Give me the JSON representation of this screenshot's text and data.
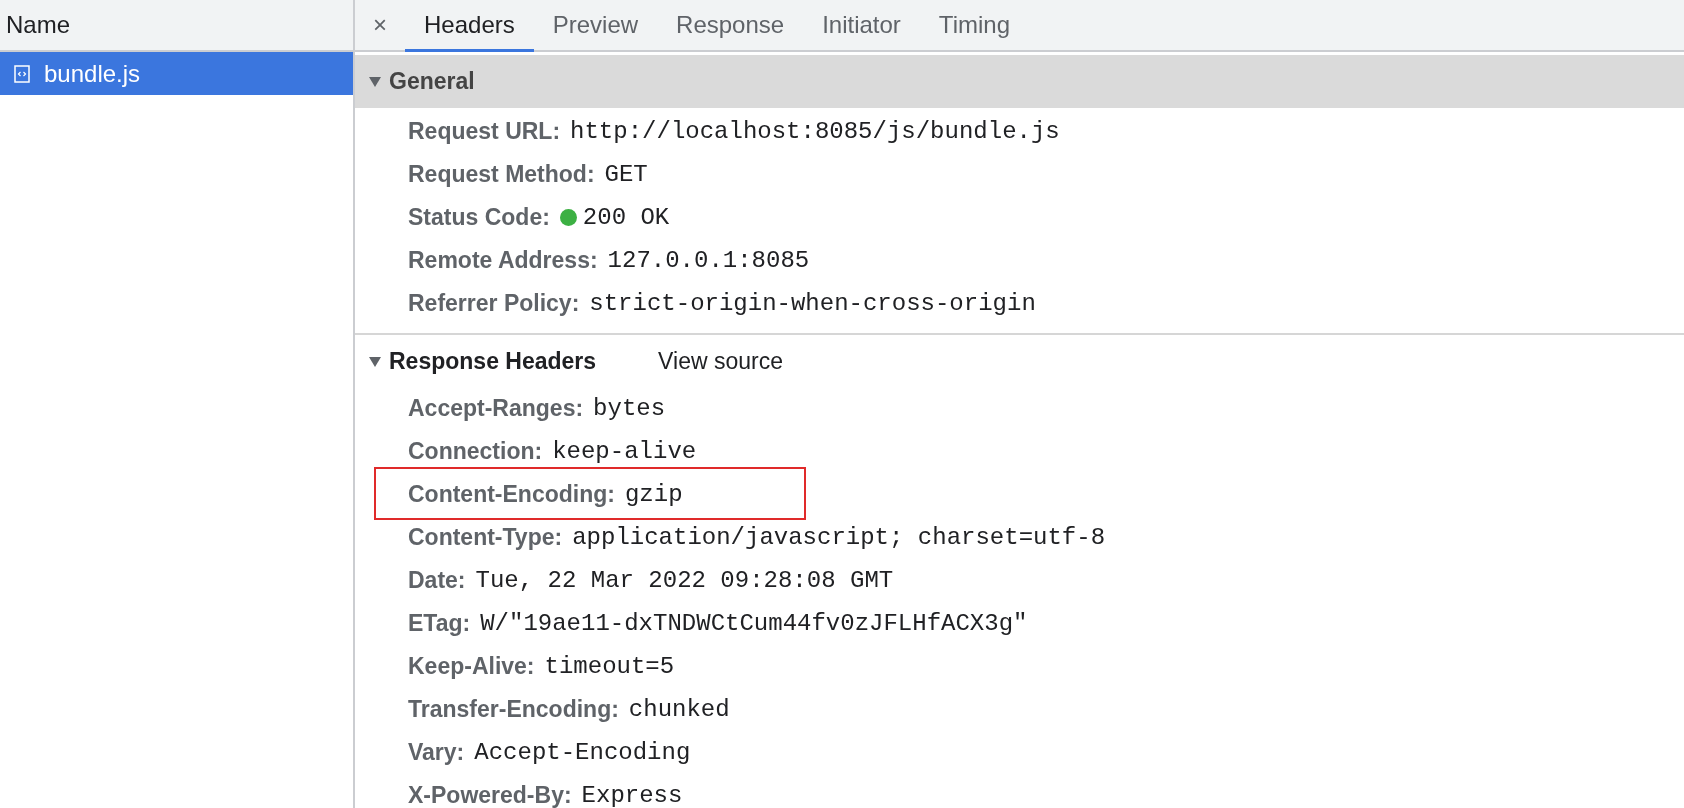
{
  "sidebar": {
    "header": "Name",
    "items": [
      {
        "name": "bundle.js",
        "selected": true
      }
    ]
  },
  "close": "×",
  "tabs": [
    {
      "label": "Headers",
      "selected": true
    },
    {
      "label": "Preview",
      "selected": false
    },
    {
      "label": "Response",
      "selected": false
    },
    {
      "label": "Initiator",
      "selected": false
    },
    {
      "label": "Timing",
      "selected": false
    }
  ],
  "sections": [
    {
      "title": "General",
      "kind": "shaded",
      "expanded": true,
      "rows": [
        {
          "name": "Request URL:",
          "value": "http://localhost:8085/js/bundle.js",
          "highlighted": false
        },
        {
          "name": "Request Method:",
          "value": "GET",
          "highlighted": false
        },
        {
          "name": "Status Code:",
          "value": "200 OK",
          "color": "#3cb043",
          "highlighted": false
        },
        {
          "name": "Remote Address:",
          "value": "127.0.0.1:8085",
          "highlighted": false
        },
        {
          "name": "Referrer Policy:",
          "value": "strict-origin-when-cross-origin",
          "highlighted": false
        }
      ]
    },
    {
      "title": "Response Headers",
      "kind": "plain",
      "expanded": true,
      "link": "View source",
      "rows": [
        {
          "name": "Accept-Ranges:",
          "value": "bytes",
          "highlighted": false
        },
        {
          "name": "Connection:",
          "value": "keep-alive",
          "highlighted": false
        },
        {
          "name": "Content-Encoding:",
          "value": "gzip",
          "highlighted": true
        },
        {
          "name": "Content-Type:",
          "value": "application/javascript; charset=utf-8",
          "highlighted": false
        },
        {
          "name": "Date:",
          "value": "Tue, 22 Mar 2022 09:28:08 GMT",
          "highlighted": false
        },
        {
          "name": "ETag:",
          "value": "W/\"19ae11-dxTNDWCtCum44fv0zJFLHfACX3g\"",
          "highlighted": false
        },
        {
          "name": "Keep-Alive:",
          "value": "timeout=5",
          "highlighted": false
        },
        {
          "name": "Transfer-Encoding:",
          "value": "chunked",
          "highlighted": false
        },
        {
          "name": "Vary:",
          "value": "Accept-Encoding",
          "highlighted": false
        },
        {
          "name": "X-Powered-By:",
          "value": "Express",
          "highlighted": false
        }
      ]
    }
  ]
}
